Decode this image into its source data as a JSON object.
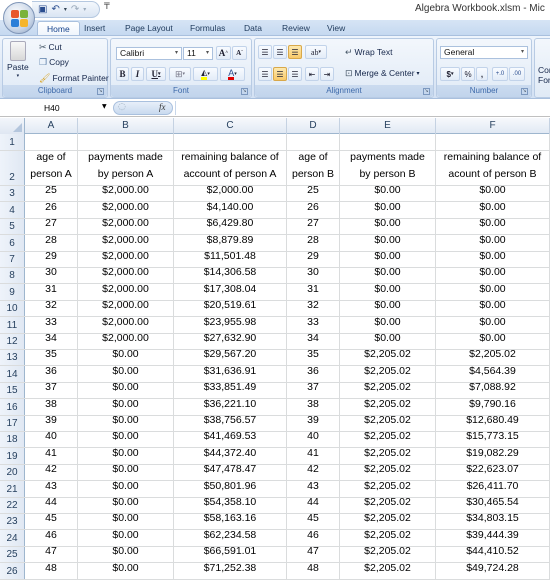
{
  "window": {
    "title": "Algebra Workbook.xlsm - Mic",
    "office_button": "office-button",
    "quick_access": [
      {
        "name": "save-icon",
        "glyph": "💾"
      },
      {
        "name": "undo-icon",
        "glyph": "↶"
      },
      {
        "name": "redo-icon",
        "glyph": "↷"
      }
    ]
  },
  "ribbon": {
    "tabs": [
      "Home",
      "Insert",
      "Page Layout",
      "Formulas",
      "Data",
      "Review",
      "View"
    ],
    "active_tab": "Home",
    "clipboard": {
      "label": "Clipboard",
      "paste": "Paste",
      "cut": "Cut",
      "copy": "Copy",
      "format_painter": "Format Painter"
    },
    "font": {
      "label": "Font",
      "font_name": "Calibri",
      "font_size": "11",
      "grow": "A",
      "shrink": "A",
      "bold": "B",
      "italic": "I",
      "underline": "U"
    },
    "alignment": {
      "label": "Alignment",
      "wrap_text": "Wrap Text",
      "merge_center": "Merge & Center"
    },
    "number": {
      "label": "Number",
      "format": "General",
      "currency": "$",
      "percent": "%",
      "comma": ",",
      "increase_decimal": "+.0",
      "decrease_decimal": ".00"
    },
    "styles": {
      "conditional_formatting_partial": "Con\nFor"
    }
  },
  "formula_bar": {
    "name_box": "H40",
    "fx": "fx",
    "formula": ""
  },
  "sheet": {
    "columns": [
      "A",
      "B",
      "C",
      "D",
      "E",
      "F"
    ],
    "headers": [
      "age of\nperson A",
      "payments made\nby person A",
      "remaining balance of\naccount of person A",
      "age of\nperson B",
      "payments made\nby person B",
      "remaining balance of\nacount of person B"
    ],
    "rows": [
      [
        "25",
        "$2,000.00",
        "$2,000.00",
        "25",
        "$0.00",
        "$0.00"
      ],
      [
        "26",
        "$2,000.00",
        "$4,140.00",
        "26",
        "$0.00",
        "$0.00"
      ],
      [
        "27",
        "$2,000.00",
        "$6,429.80",
        "27",
        "$0.00",
        "$0.00"
      ],
      [
        "28",
        "$2,000.00",
        "$8,879.89",
        "28",
        "$0.00",
        "$0.00"
      ],
      [
        "29",
        "$2,000.00",
        "$11,501.48",
        "29",
        "$0.00",
        "$0.00"
      ],
      [
        "30",
        "$2,000.00",
        "$14,306.58",
        "30",
        "$0.00",
        "$0.00"
      ],
      [
        "31",
        "$2,000.00",
        "$17,308.04",
        "31",
        "$0.00",
        "$0.00"
      ],
      [
        "32",
        "$2,000.00",
        "$20,519.61",
        "32",
        "$0.00",
        "$0.00"
      ],
      [
        "33",
        "$2,000.00",
        "$23,955.98",
        "33",
        "$0.00",
        "$0.00"
      ],
      [
        "34",
        "$2,000.00",
        "$27,632.90",
        "34",
        "$0.00",
        "$0.00"
      ],
      [
        "35",
        "$0.00",
        "$29,567.20",
        "35",
        "$2,205.02",
        "$2,205.02"
      ],
      [
        "36",
        "$0.00",
        "$31,636.91",
        "36",
        "$2,205.02",
        "$4,564.39"
      ],
      [
        "37",
        "$0.00",
        "$33,851.49",
        "37",
        "$2,205.02",
        "$7,088.92"
      ],
      [
        "38",
        "$0.00",
        "$36,221.10",
        "38",
        "$2,205.02",
        "$9,790.16"
      ],
      [
        "39",
        "$0.00",
        "$38,756.57",
        "39",
        "$2,205.02",
        "$12,680.49"
      ],
      [
        "40",
        "$0.00",
        "$41,469.53",
        "40",
        "$2,205.02",
        "$15,773.15"
      ],
      [
        "41",
        "$0.00",
        "$44,372.40",
        "41",
        "$2,205.02",
        "$19,082.29"
      ],
      [
        "42",
        "$0.00",
        "$47,478.47",
        "42",
        "$2,205.02",
        "$22,623.07"
      ],
      [
        "43",
        "$0.00",
        "$50,801.96",
        "43",
        "$2,205.02",
        "$26,411.70"
      ],
      [
        "44",
        "$0.00",
        "$54,358.10",
        "44",
        "$2,205.02",
        "$30,465.54"
      ],
      [
        "45",
        "$0.00",
        "$58,163.16",
        "45",
        "$2,205.02",
        "$34,803.15"
      ],
      [
        "46",
        "$0.00",
        "$62,234.58",
        "46",
        "$2,205.02",
        "$39,444.39"
      ],
      [
        "47",
        "$0.00",
        "$66,591.01",
        "47",
        "$2,205.02",
        "$44,410.52"
      ],
      [
        "48",
        "$0.00",
        "$71,252.38",
        "48",
        "$2,205.02",
        "$49,724.28"
      ]
    ]
  },
  "colors": {
    "ribbon_tab_text": "#15428b",
    "header_text": "#27415f",
    "grid_line": "#dadcdd",
    "header_border": "#9eb6ce"
  }
}
